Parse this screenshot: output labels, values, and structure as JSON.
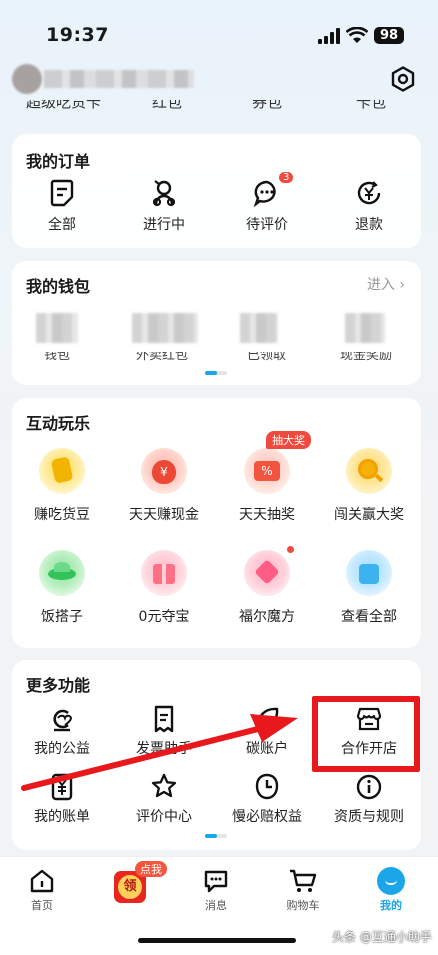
{
  "status": {
    "time": "19:37",
    "battery": "98"
  },
  "cut_row": [
    "超级吃货卡",
    "红包",
    "券包",
    "卡包"
  ],
  "orders": {
    "title": "我的订单",
    "items": [
      {
        "label": "全部",
        "icon": "order-doc-icon"
      },
      {
        "label": "进行中",
        "icon": "rider-icon"
      },
      {
        "label": "待评价",
        "icon": "comment-icon",
        "badge": "3"
      },
      {
        "label": "退款",
        "icon": "refund-icon"
      }
    ]
  },
  "wallet": {
    "title": "我的钱包",
    "enter_label": "进入",
    "cut_labels": [
      "钱包",
      "外卖红包",
      "已领取",
      "现金奖励"
    ]
  },
  "fun": {
    "title": "互动玩乐",
    "badge": "抽大奖",
    "items": [
      {
        "label": "赚吃货豆",
        "icon": "bean-icon"
      },
      {
        "label": "天天赚现金",
        "icon": "money-bag-icon"
      },
      {
        "label": "天天抽奖",
        "icon": "lottery-ticket-icon"
      },
      {
        "label": "闯关赢大奖",
        "icon": "magnifier-coin-icon"
      },
      {
        "label": "饭搭子",
        "icon": "plate-icon"
      },
      {
        "label": "0元夺宝",
        "icon": "gift-box-icon"
      },
      {
        "label": "福尔魔方",
        "icon": "cube-icon"
      },
      {
        "label": "查看全部",
        "icon": "blocks-icon"
      }
    ]
  },
  "more": {
    "title": "更多功能",
    "items": [
      {
        "label": "我的公益",
        "icon": "charity-icon"
      },
      {
        "label": "发票助手",
        "icon": "invoice-icon"
      },
      {
        "label": "碳账户",
        "icon": "leaf-icon"
      },
      {
        "label": "合作开店",
        "icon": "store-icon"
      },
      {
        "label": "我的账单",
        "icon": "bill-icon"
      },
      {
        "label": "评价中心",
        "icon": "star-icon"
      },
      {
        "label": "慢必赔权益",
        "icon": "clock-icon"
      },
      {
        "label": "资质与规则",
        "icon": "info-icon"
      }
    ]
  },
  "tabbar": {
    "items": [
      {
        "label": "首页",
        "icon": "home-icon"
      },
      {
        "label": "",
        "icon": "coupon-lingbadge-icon",
        "badge": "点我",
        "center": "领"
      },
      {
        "label": "消息",
        "icon": "message-icon"
      },
      {
        "label": "购物车",
        "icon": "cart-icon"
      },
      {
        "label": "我的",
        "icon": "profile-icon",
        "active": true
      }
    ]
  },
  "watermark": "头条 @互通小助手",
  "colors": {
    "accent_red": "#e8191c",
    "tab_active": "#1aa6e8",
    "badge_red": "#f04a3e"
  }
}
